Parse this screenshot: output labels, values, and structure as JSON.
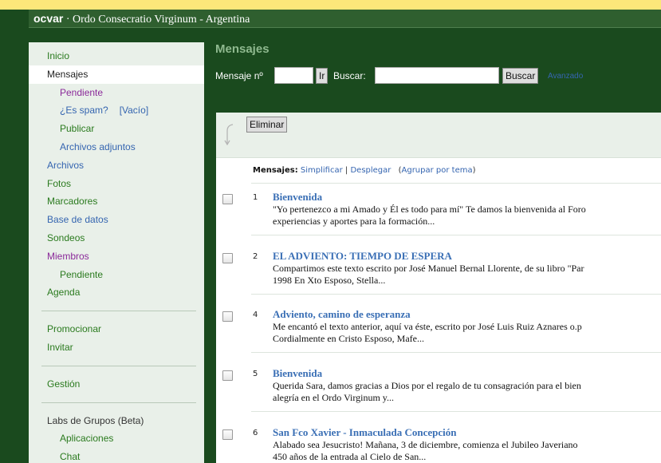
{
  "header": {
    "brand": "ocvar",
    "title": " · Ordo Consecratio Virginum - Argentina"
  },
  "sidebar": {
    "items": [
      {
        "label": "Inicio"
      },
      {
        "label": "Mensajes"
      },
      {
        "label": "Pendiente"
      },
      {
        "label": "¿Es spam?",
        "extra": "[Vacío]"
      },
      {
        "label": "Publicar"
      },
      {
        "label": "Archivos adjuntos"
      },
      {
        "label": "Archivos"
      },
      {
        "label": "Fotos"
      },
      {
        "label": "Marcadores"
      },
      {
        "label": "Base de datos"
      },
      {
        "label": "Sondeos"
      },
      {
        "label": "Miembros"
      },
      {
        "label": "Pendiente"
      },
      {
        "label": "Agenda"
      }
    ],
    "group2": [
      {
        "label": "Promocionar"
      },
      {
        "label": "Invitar"
      }
    ],
    "group3": [
      {
        "label": "Gestión"
      }
    ],
    "labs": {
      "title": "Labs de Grupos (Beta)",
      "items": [
        {
          "label": "Aplicaciones"
        },
        {
          "label": "Chat"
        }
      ]
    }
  },
  "main": {
    "heading": "Mensajes",
    "search": {
      "msg_label": "Mensaje nº",
      "msg_value": "",
      "ir_label": "Ir",
      "buscar_label": "Buscar:",
      "buscar_value": "",
      "buscar_button": "Buscar",
      "advanced_link": "Avanzado"
    },
    "toolbar": {
      "delete_label": "Eliminar"
    },
    "list_header": {
      "label": "Mensajes:",
      "simplify": "Simplificar",
      "separator": "|",
      "expand": "Desplegar",
      "group_open": "(",
      "group_by_topic": "Agrupar por tema",
      "group_close": ")"
    },
    "messages": [
      {
        "num": "1",
        "title": "Bienvenida",
        "line1": "\"Yo pertenezco a mi Amado y Él es todo para mí\" Te damos la bienvenida al Foro",
        "line2": "experiencias y aportes para la formación..."
      },
      {
        "num": "2",
        "title": "EL ADVIENTO: TIEMPO DE ESPERA",
        "line1": "Compartimos este texto escrito por José Manuel Bernal Llorente, de su libro \"Par",
        "line2": "1998 En Xto Esposo, Stella..."
      },
      {
        "num": "4",
        "title": "Adviento, camino de esperanza",
        "line1": "Me encantó el texto anterior, aquí va éste, escrito por José Luis Ruiz Aznares o.p",
        "line2": "Cordialmente en Cristo Esposo, Mafe..."
      },
      {
        "num": "5",
        "title": "Bienvenida",
        "line1": "Querida Sara, damos gracias a Dios por el regalo de tu consagración para el bien",
        "line2": "alegría en el Ordo Virginum y..."
      },
      {
        "num": "6",
        "title": "San Fco Xavier - Inmaculada Concepción",
        "line1": "Alabado sea Jesucristo! Mañana, 3 de diciembre, comienza el Jubileo Javeriano",
        "line2": "450 años de la entrada al Cielo de San..."
      }
    ]
  },
  "colors": {
    "frame_green": "#1a4a1e",
    "topbar_green": "#2f5f2f",
    "sidebar_bg": "#e9f0e9",
    "nav_green": "#2a7a1e",
    "nav_purple": "#8b2a9a",
    "link_blue": "#3565b0",
    "title_blue": "#3a6fb5",
    "top_yellow": "#fce77a"
  }
}
